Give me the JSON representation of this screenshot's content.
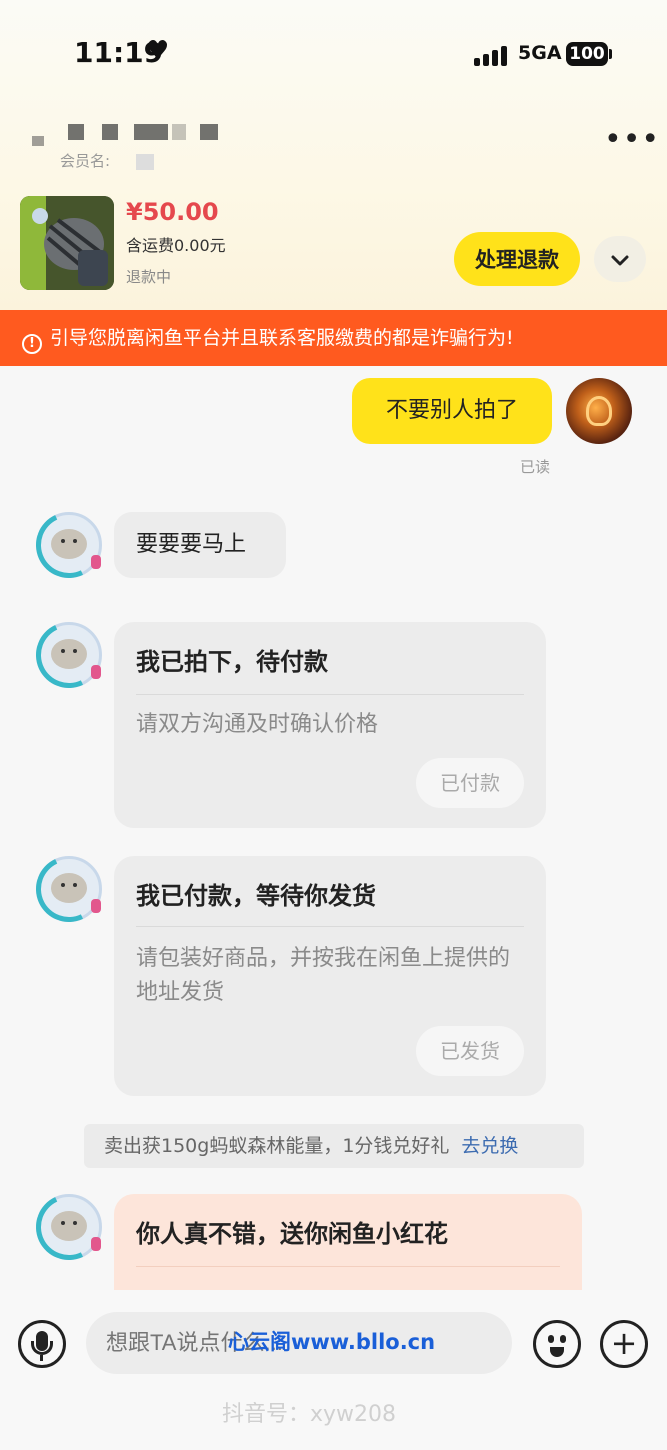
{
  "status_bar": {
    "time": "11:19",
    "network": "5GA",
    "battery": "100"
  },
  "header": {
    "member_label": "会员名:"
  },
  "product": {
    "price": "¥50.00",
    "shipping": "含运费0.00元",
    "status": "退款中",
    "action_label": "处理退款"
  },
  "warning": {
    "text": "引导您脱离闲鱼平台并且联系客服缴费的都是诈骗行为!"
  },
  "messages": {
    "mine_1": "不要别人拍了",
    "read_receipt": "已读",
    "other_1": "要要要马上",
    "card_1": {
      "title": "我已拍下，待付款",
      "body": "请双方沟通及时确认价格",
      "button": "已付款"
    },
    "card_2": {
      "title": "我已付款，等待你发货",
      "body": "请包装好商品，并按我在闲鱼上提供的地址发货",
      "button": "已发货"
    },
    "promo": {
      "text": "卖出获150g蚂蚁森林能量，1分钱兑好礼",
      "link": "去兑换"
    },
    "card_3": {
      "title": "你人真不错，送你闲鱼小红花"
    }
  },
  "composer": {
    "placeholder": "想跟TA说点什么...",
    "watermark": "心云阁www.bllo.cn"
  },
  "footer_watermark": "抖音号：xyw208",
  "colors": {
    "accent_yellow": "#ffe21a",
    "warning_orange": "#ff5a1f",
    "price_red": "#e5484d",
    "link_blue": "#3c6bb0"
  }
}
